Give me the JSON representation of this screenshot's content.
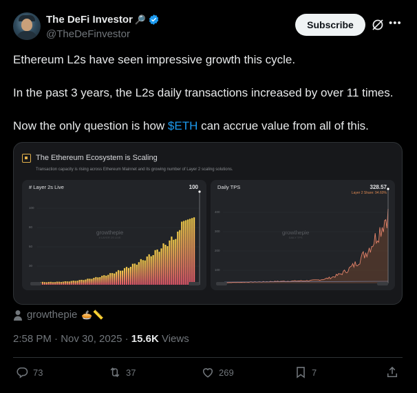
{
  "author": {
    "display_name": "The DeFi Investor",
    "emoji_badge": "🔎",
    "handle": "@TheDeFinvestor",
    "verified": true
  },
  "header": {
    "subscribe_label": "Subscribe"
  },
  "tweet": {
    "paragraphs": [
      "Ethereum L2s have seen impressive growth this cycle.",
      "In the past 3 years, the L2s daily transactions increased by over 11 times."
    ],
    "last_paragraph_prefix": "Now the only question is how ",
    "cashtag": "$ETH",
    "last_paragraph_suffix": " can accrue value from all of this."
  },
  "media": {
    "title": "The Ethereum Ecosystem is Scaling",
    "subtitle": "Transaction capacity is rising across Ethereum Mainnet and its growing number of Layer 2 scaling solutions.",
    "watermark": "growthepie",
    "left_panel": {
      "title": "# Layer 2s Live",
      "value": "100",
      "watermark_sub": "# LAYER 2S LIVE",
      "y_ticks": [
        "100",
        "80",
        "60",
        "30"
      ]
    },
    "right_panel": {
      "title": "Daily TPS",
      "value": "328.57",
      "note": "Layer 2 Share: 94.60%",
      "watermark_sub": "DAILY TPS",
      "y_ticks": [
        "400",
        "300",
        "200",
        "100"
      ]
    },
    "colors": {
      "bar_top": "#f5d04a",
      "bar_bottom": "#e0556b",
      "line": "#e4836a",
      "line_fill": "#7a4a2e"
    }
  },
  "source": {
    "name": "growthepie",
    "emoji": "🥧📏"
  },
  "meta": {
    "time": "2:58 PM · Nov 30, 2025 · ",
    "views_count": "15.6K",
    "views_label": " Views"
  },
  "actions": {
    "replies": "73",
    "reposts": "37",
    "likes": "269",
    "bookmarks": "7"
  }
}
